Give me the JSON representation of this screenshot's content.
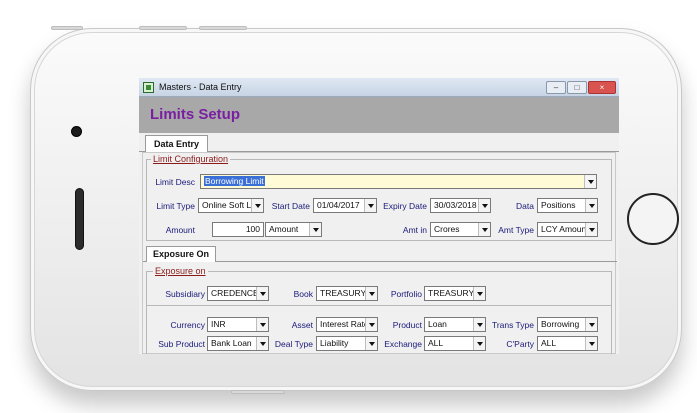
{
  "window": {
    "title": "Masters - Data Entry",
    "controls": [
      "minimize-icon",
      "maximize-icon",
      "close-icon"
    ]
  },
  "page": {
    "title": "Limits Setup"
  },
  "tabs": [
    {
      "label": "Data Entry",
      "active": true
    }
  ],
  "limit_configuration": {
    "legend": "Limit Configuration",
    "limit_desc": {
      "label": "Limit Desc",
      "value": "Borrowing Limit"
    },
    "limit_type": {
      "label": "Limit Type",
      "value": "Online Soft L"
    },
    "start_date": {
      "label": "Start Date",
      "value": "01/04/2017"
    },
    "expiry_date": {
      "label": "Expiry Date",
      "value": "30/03/2018"
    },
    "data": {
      "label": "Data",
      "value": "Positions"
    },
    "amount": {
      "label": "Amount",
      "value": "100",
      "unit": "Amount"
    },
    "amt_in": {
      "label": "Amt in",
      "value": "Crores"
    },
    "amt_type": {
      "label": "Amt Type",
      "value": "LCY Amount"
    }
  },
  "sub_tabs": [
    {
      "label": "Exposure On",
      "active": true
    }
  ],
  "exposure_on": {
    "legend": "Exposure on",
    "subsidiary": {
      "label": "Subsidiary",
      "value": "CREDENCE"
    },
    "book": {
      "label": "Book",
      "value": "TREASURY"
    },
    "portfolio": {
      "label": "Portfolio",
      "value": "TREASURY"
    },
    "currency": {
      "label": "Currency",
      "value": "INR"
    },
    "asset": {
      "label": "Asset",
      "value": "Interest Rate"
    },
    "product": {
      "label": "Product",
      "value": "Loan"
    },
    "trans_type": {
      "label": "Trans Type",
      "value": "Borrowing"
    },
    "sub_product": {
      "label": "Sub Product",
      "value": "Bank Loan"
    },
    "deal_type": {
      "label": "Deal Type",
      "value": "Liability"
    },
    "exchange": {
      "label": "Exchange",
      "value": "ALL"
    },
    "cparty": {
      "label": "C'Party",
      "value": "ALL"
    }
  },
  "colors": {
    "title": "#7b1fa2",
    "header_band": "#a8a8a8",
    "legend": "#8b1a1a",
    "label": "#1a1a7a",
    "selection": "#3a6fd8",
    "desc_field": "#fffbd6"
  }
}
